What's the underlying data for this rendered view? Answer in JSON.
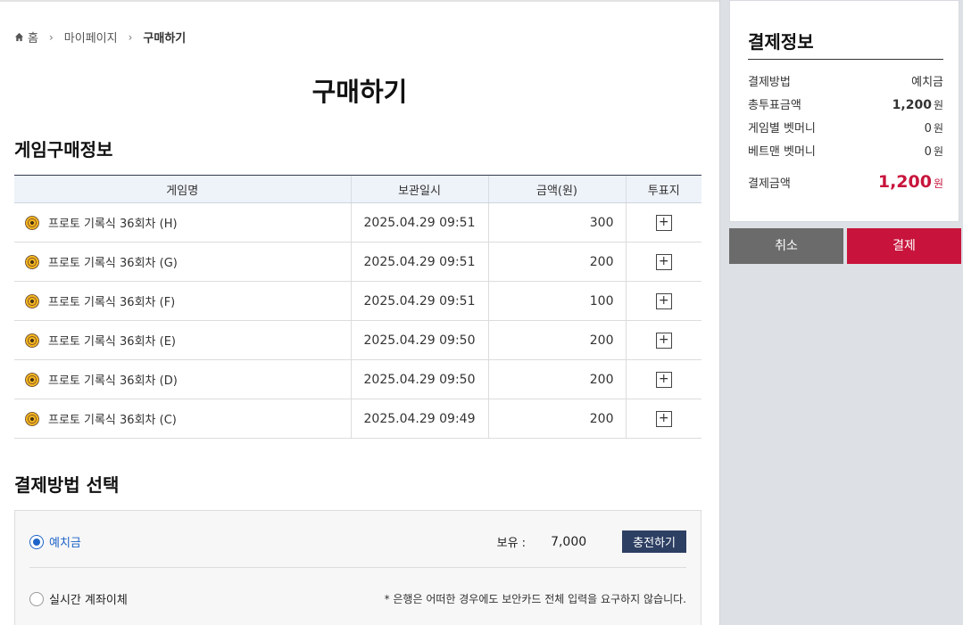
{
  "breadcrumb": {
    "home": "홈",
    "mypage": "마이페이지",
    "current": "구매하기"
  },
  "page_title": "구매하기",
  "game_section": {
    "title": "게임구매정보",
    "columns": [
      "게임명",
      "보관일시",
      "금액(원)",
      "투표지"
    ],
    "rows": [
      {
        "name": "프로토 기록식 36회차 (H)",
        "date": "2025.04.29 09:51",
        "amount": "300",
        "vote": "+"
      },
      {
        "name": "프로토 기록식 36회차 (G)",
        "date": "2025.04.29 09:51",
        "amount": "200",
        "vote": "+"
      },
      {
        "name": "프로토 기록식 36회차 (F)",
        "date": "2025.04.29 09:51",
        "amount": "100",
        "vote": "+"
      },
      {
        "name": "프로토 기록식 36회차 (E)",
        "date": "2025.04.29 09:50",
        "amount": "200",
        "vote": "+"
      },
      {
        "name": "프로토 기록식 36회차 (D)",
        "date": "2025.04.29 09:50",
        "amount": "200",
        "vote": "+"
      },
      {
        "name": "프로토 기록식 36회차 (C)",
        "date": "2025.04.29 09:49",
        "amount": "200",
        "vote": "+"
      }
    ]
  },
  "payment_section": {
    "title": "결제방법 선택",
    "deposit": {
      "label": "예치금",
      "selected": true,
      "balance_label": "보유 :",
      "balance": "7,000",
      "charge_button": "충전하기"
    },
    "transfer": {
      "label": "실시간 계좌이체",
      "selected": false,
      "notice": "* 은행은 어떠한 경우에도 보안카드 전체 입력을 요구하지 않습니다."
    }
  },
  "summary": {
    "title": "결제정보",
    "method_label": "결제방법",
    "method_value": "예치금",
    "total_label": "총투표금액",
    "total_value": "1,200",
    "game_bet_label": "게임별 벳머니",
    "game_bet_value": "0",
    "betman_label": "베트맨 벳머니",
    "betman_value": "0",
    "pay_label": "결제금액",
    "pay_value": "1,200",
    "unit": "원"
  },
  "buttons": {
    "cancel": "취소",
    "pay": "결제"
  },
  "colors": {
    "accent_red": "#c8143c",
    "navy": "#2d3f63",
    "radio_blue": "#1e64c8",
    "cancel_gray": "#6b6b6b"
  }
}
